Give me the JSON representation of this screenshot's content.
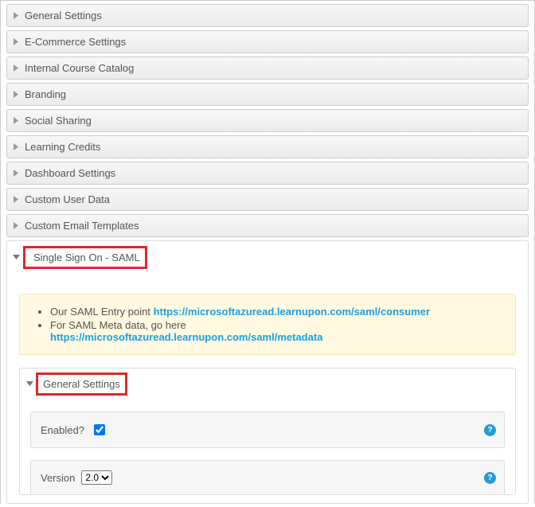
{
  "collapsed_sections": [
    {
      "label": "General Settings"
    },
    {
      "label": "E-Commerce Settings"
    },
    {
      "label": "Internal Course Catalog"
    },
    {
      "label": "Branding"
    },
    {
      "label": "Social Sharing"
    },
    {
      "label": "Learning Credits"
    },
    {
      "label": "Dashboard Settings"
    },
    {
      "label": "Custom User Data"
    },
    {
      "label": "Custom Email Templates"
    }
  ],
  "sso": {
    "title": "Single Sign On - SAML",
    "notice": {
      "line1_prefix": "Our SAML Entry point ",
      "line1_url": "https://microsoftazuread.learnupon.com/saml/consumer",
      "line2_prefix": "For SAML Meta data, go here ",
      "line2_url": "https://microsoftazuread.learnupon.com/saml/metadata"
    },
    "general": {
      "title": "General Settings",
      "enabled_label": "Enabled?",
      "enabled_checked": true,
      "version_label": "Version",
      "version_value": "2.0",
      "help_glyph": "?"
    }
  }
}
